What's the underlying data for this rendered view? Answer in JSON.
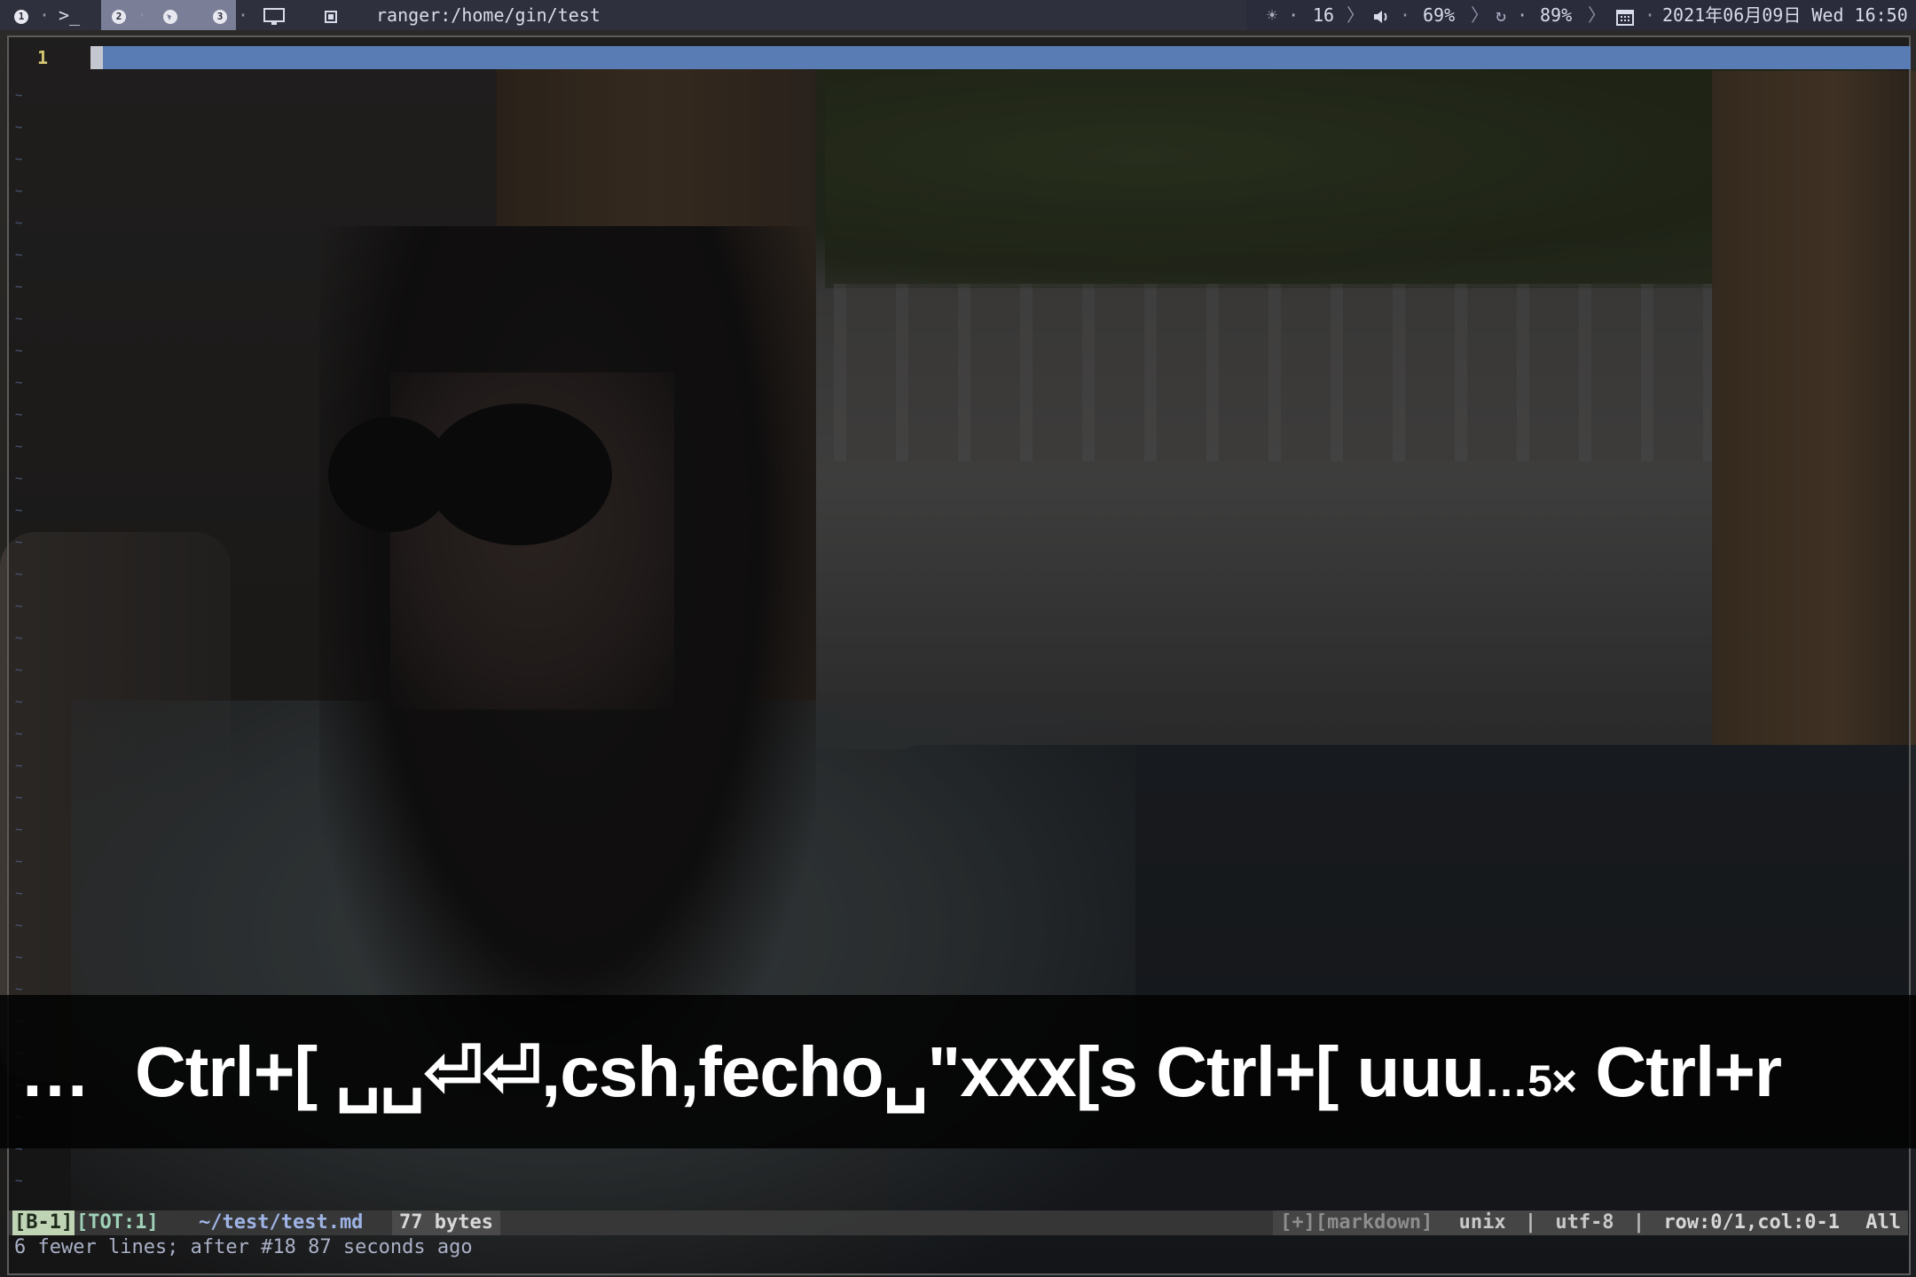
{
  "topbar": {
    "workspaces": [
      "1",
      "2",
      "3"
    ],
    "terminal_glyph": ">_",
    "active_title": "ranger:/home/gin/test",
    "brightness": "16",
    "volume": "69%",
    "battery": "89%",
    "datetime": "2021年06月09日 Wed 16:50",
    "icons": [
      "terminal-icon",
      "browser-icon",
      "monitor-icon",
      "window-icon",
      "brightness-icon",
      "volume-icon",
      "battery-icon",
      "calendar-icon"
    ]
  },
  "editor": {
    "line_number": "1",
    "tilde": "~"
  },
  "keystrokes": {
    "ellipsis": "…",
    "sequence": "Ctrl+[ ␣␣⏎⏎,csh,fecho␣\"xxx[s Ctrl+[ uuu",
    "repeat_suffix": "…5×",
    "tail": " Ctrl+r"
  },
  "statusline": {
    "buffer": "[B-1]",
    "total": "[TOT:1]",
    "file": "~/test/test.md",
    "size": "77 bytes",
    "filetype": "[+][markdown]",
    "format": "unix",
    "pipe": "|",
    "encoding": "utf-8",
    "position": "row:0/1,col:0-1",
    "scroll": "All"
  },
  "message": "6 fewer lines; after #18  87 seconds ago",
  "colors": {
    "cursorline": "#5a7cb4",
    "line_number": "#d6c873",
    "buffer_badge": "#bfd3b5",
    "filename": "#9fb4e6"
  }
}
